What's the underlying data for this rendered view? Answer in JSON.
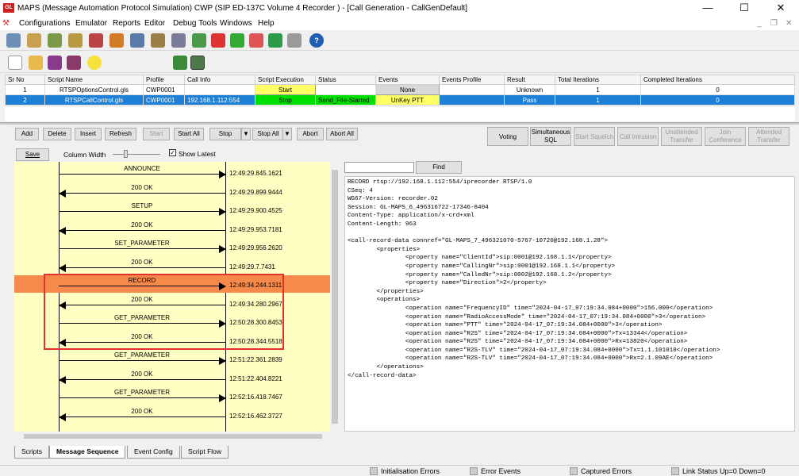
{
  "window": {
    "title": "MAPS (Message Automation Protocol Simulation) CWP (SIP ED-137C Volume 4 Recorder ) - [Call Generation  - CallGenDefault]",
    "logo": "GL",
    "min": "—",
    "max": "☐",
    "close": "✕"
  },
  "menu": [
    "Configurations",
    "Emulator",
    "Reports",
    "Editor",
    "Debug Tools",
    "Windows",
    "Help"
  ],
  "grid": {
    "headers": [
      "Sr No",
      "Script Name",
      "Profile",
      "Call Info",
      "Script Execution",
      "Status",
      "Events",
      "Events Profile",
      "Result",
      "Total Iterations",
      "Completed Iterations"
    ],
    "rows": [
      [
        "1",
        "RTSPOptionsControl.gls",
        "CWP0001",
        "",
        "Start",
        "",
        "None",
        "",
        "Unknown",
        "1",
        "0"
      ],
      [
        "2",
        "RTSPCallControl.gls",
        "CWP0001",
        "192.168.1.112:554",
        "Stop",
        "Send_File-Started",
        "UnKey PTT",
        "",
        "Pass",
        "1",
        "0"
      ]
    ]
  },
  "buttons": {
    "add": "Add",
    "delete": "Delete",
    "insert": "Insert",
    "refresh": "Refresh",
    "start": "Start",
    "start_all": "Start All",
    "stop": "Stop",
    "stop_all": "Stop All",
    "abort": "Abort",
    "abort_all": "Abort All",
    "voting": "Voting",
    "simsql1": "Simultaneous",
    "simsql2": "SQL",
    "squelch": "Start Squelch",
    "intrusion": "Call Intrusion",
    "unattended1": "Unattended",
    "unattended2": "Transfer",
    "join1": "Join",
    "join2": "Conference",
    "attended1": "Attended",
    "attended2": "Transfer",
    "save": "Save",
    "find": "Find"
  },
  "seq_toolbar": {
    "col_width": "Column Width",
    "show_latest": "Show Latest"
  },
  "sequence": [
    {
      "label": "ANNOUNCE",
      "ts": "12:49:29.845.1621",
      "dir": "r"
    },
    {
      "label": "200 OK",
      "ts": "12:49:29.899.9444",
      "dir": "l"
    },
    {
      "label": "SETUP",
      "ts": "12:49:29.900.4525",
      "dir": "r"
    },
    {
      "label": "200 OK",
      "ts": "12:49:29.953.7181",
      "dir": "l"
    },
    {
      "label": "SET_PARAMETER",
      "ts": "12:49:29.956.2620",
      "dir": "r"
    },
    {
      "label": "200 OK",
      "ts": "12:49:29.7.7431",
      "dir": "l"
    },
    {
      "label": "RECORD",
      "ts": "12:49:34.244.1311",
      "dir": "r",
      "hl": true
    },
    {
      "label": "200 OK",
      "ts": "12:49:34.280.2967",
      "dir": "l"
    },
    {
      "label": "GET_PARAMETER",
      "ts": "12:50:28.300.8453",
      "dir": "r"
    },
    {
      "label": "200 OK",
      "ts": "12:50:28.344.5518",
      "dir": "l"
    },
    {
      "label": "GET_PARAMETER",
      "ts": "12:51:22.361.2839",
      "dir": "r"
    },
    {
      "label": "200 OK",
      "ts": "12:51:22.404.8221",
      "dir": "l"
    },
    {
      "label": "GET_PARAMETER",
      "ts": "12:52:16.418.7467",
      "dir": "r"
    },
    {
      "label": "200 OK",
      "ts": "12:52:16.462.3727",
      "dir": "l"
    }
  ],
  "code": [
    "RECORD rtsp://192.168.1.112:554/iprecorder RTSP/1.0",
    "CSeq: 4",
    "WG67-Version: recorder.02",
    "Session: GL-MAPS_6_496316722-17346-8404",
    "Content-Type: application/x-crd+xml",
    "Content-Length: 963",
    "",
    "<call-record-data connref=\"GL-MAPS_7_496321070-5767-10720@192.168.1.28\">",
    "        <properties>",
    "                <property name=\"ClientId\">sip:0001@192.168.1.1</property>",
    "                <property name=\"CallingNr\">sip:0001@192.168.1.1</property>",
    "                <property name=\"CalledNr\">sip:0002@192.168.1.2</property>",
    "                <property name=\"Direction\">2</property>",
    "        </properties>",
    "        <operations>",
    "                <operation name=\"FrequencyID\" time=\"2024-04-17_07:19:34.084+0000\">156.000</operation>",
    "                <operation name=\"RadioAccessMode\" time=\"2024-04-17_07:19:34.084+0000\">3</operation>",
    "                <operation name=\"PTT\" time=\"2024-04-17_07:19:34.084+0000\">3</operation>",
    "                <operation name=\"R2S\" time=\"2024-04-17_07:19:34.084+0000\">Tx=13344</operation>",
    "                <operation name=\"R2S\" time=\"2024-04-17_07:19:34.084+0000\">Rx=13820</operation>",
    "                <operation name=\"R2S-TLV\" time=\"2024-04-17_07:19:34.084+0000\">Tx=1.1.101010</operation>",
    "                <operation name=\"R2S-TLV\" time=\"2024-04-17_07:19:34.084+0000\">Rx=2.1.09AE</operation>",
    "        </operations>",
    "</call-record-data>"
  ],
  "tabs": [
    "Scripts",
    "Message Sequence",
    "Event Config",
    "Script Flow"
  ],
  "status": [
    "Initialisation Errors",
    "Error Events",
    "Captured Errors",
    "Link Status Up=0 Down=0"
  ],
  "colors": {
    "selected_row": "#1e7fd6",
    "start": "#ffff66",
    "stop": "#00e000",
    "highlight": "#f58a4a",
    "seq_bg": "#ffffc4"
  }
}
